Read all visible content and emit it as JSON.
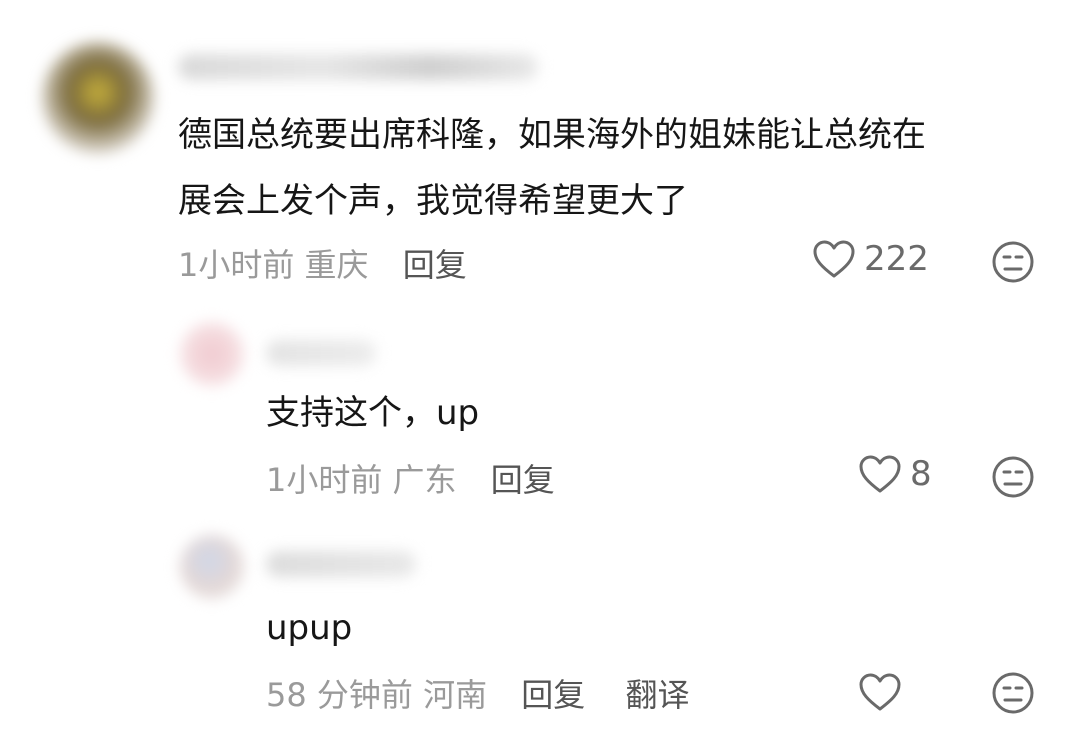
{
  "comments": [
    {
      "text_line1": "德国总统要出席科隆，如果海外的姐妹能让总统在",
      "text_line2": "展会上发个声，我觉得希望更大了",
      "time": "1小时前",
      "location": "重庆",
      "reply_label": "回复",
      "likes": "222"
    },
    {
      "text": "支持这个，up",
      "time": "1小时前",
      "location": "广东",
      "reply_label": "回复",
      "likes": "8"
    },
    {
      "text": "upup",
      "time": "58 分钟前",
      "location": "河南",
      "reply_label": "回复",
      "translate_label": "翻译",
      "likes": ""
    }
  ],
  "colors": {
    "text": "#161616",
    "meta": "#9a9a9a",
    "action": "#555555",
    "icon": "#6a6a6a",
    "background": "#ffffff"
  },
  "icons": [
    "heart-outline-icon",
    "neutral-face-icon"
  ]
}
